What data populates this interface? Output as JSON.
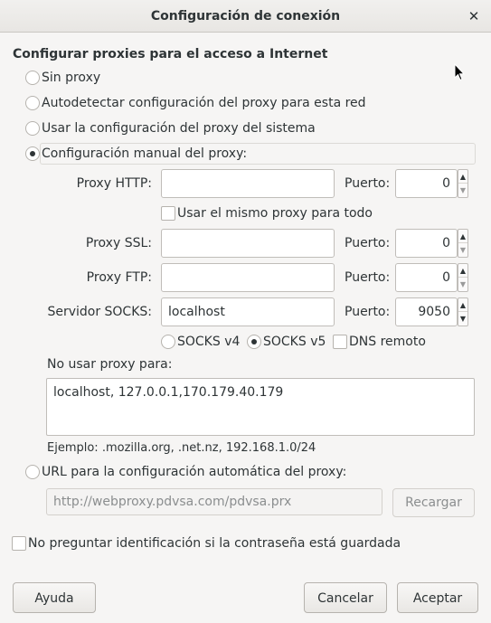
{
  "window": {
    "title": "Configuración de conexión",
    "close_glyph": "✕"
  },
  "section_title": "Configurar proxies para el acceso a Internet",
  "options": {
    "no_proxy": "Sin proxy",
    "auto_detect": "Autodetectar configuración del proxy para esta red",
    "system": "Usar la configuración del proxy del sistema",
    "manual": "Configuración manual del proxy:",
    "auto_url": "URL para la configuración automática del proxy:"
  },
  "selected_option": "manual",
  "manual": {
    "http_label": "Proxy HTTP:",
    "http_value": "",
    "http_port_label": "Puerto:",
    "http_port": "0",
    "same_proxy_label": "Usar el mismo proxy para todo",
    "same_proxy_checked": false,
    "ssl_label": "Proxy SSL:",
    "ssl_value": "",
    "ssl_port_label": "Puerto:",
    "ssl_port": "0",
    "ftp_label": "Proxy FTP:",
    "ftp_value": "",
    "ftp_port_label": "Puerto:",
    "ftp_port": "0",
    "socks_label": "Servidor SOCKS:",
    "socks_value": "localhost",
    "socks_port_label": "Puerto:",
    "socks_port": "9050",
    "socks_v4": "SOCKS v4",
    "socks_v5": "SOCKS v5",
    "socks_version_selected": "v5",
    "remote_dns": "DNS remoto",
    "remote_dns_checked": false
  },
  "no_proxy": {
    "label": "No usar proxy para:",
    "value": "localhost, 127.0.0.1,170.179.40.179",
    "example": "Ejemplo: .mozilla.org, .net.nz, 192.168.1.0/24"
  },
  "auto_config": {
    "url": "http://webproxy.pdvsa.com/pdvsa.prx",
    "reload_label": "Recargar"
  },
  "no_prompt_auth": "No preguntar identificación si la contraseña está guardada",
  "buttons": {
    "help": "Ayuda",
    "cancel": "Cancelar",
    "accept": "Aceptar"
  },
  "icons": {
    "close": "close-icon",
    "spin_up": "chevron-up-icon",
    "spin_down": "chevron-down-icon",
    "cursor": "mouse-pointer-icon"
  }
}
